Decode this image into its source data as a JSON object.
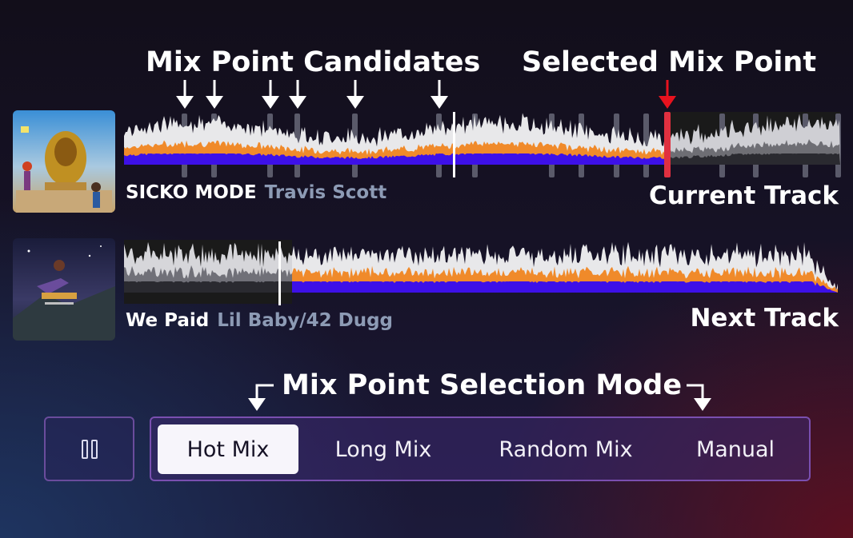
{
  "annotations": {
    "candidates": "Mix Point Candidates",
    "selected": "Selected Mix Point",
    "current_track": "Current Track",
    "next_track": "Next Track",
    "selection_mode": "Mix Point Selection Mode"
  },
  "current": {
    "title": "SICKO MODE",
    "artist": "Travis Scott"
  },
  "next": {
    "title": "We Paid",
    "artist": "Lil Baby/42 Dugg"
  },
  "modes": [
    "Hot Mix",
    "Long Mix",
    "Random Mix",
    "Manual"
  ],
  "active_mode": "Hot Mix",
  "colors": {
    "orange": "#f08a2a",
    "blue": "#3d10e8",
    "selected_marker": "#e03040",
    "arrow_red": "#e8121e"
  }
}
